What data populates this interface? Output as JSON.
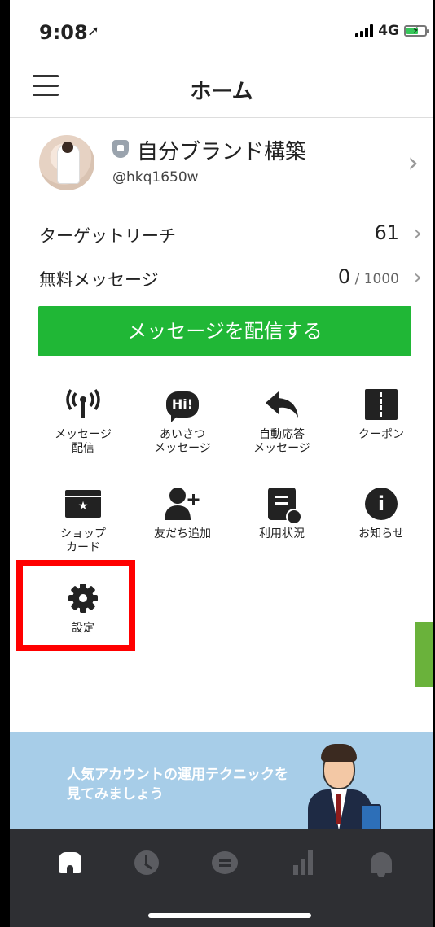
{
  "status": {
    "time": "9:08",
    "network": "4G"
  },
  "header": {
    "title": "ホーム"
  },
  "account": {
    "name": "自分ブランド構築",
    "id": "@hkq1650w"
  },
  "stats": [
    {
      "label": "ターゲットリーチ",
      "value": "61",
      "sub": ""
    },
    {
      "label": "無料メッセージ",
      "value": "0",
      "sub": " / 1000"
    }
  ],
  "send_button": {
    "label": "メッセージを配信する",
    "color": "#20b736"
  },
  "menu": [
    {
      "label": "メッセージ\n配信",
      "icon": "broadcast-icon"
    },
    {
      "label": "あいさつ\nメッセージ",
      "icon": "hi-bubble-icon",
      "icon_text": "Hi!"
    },
    {
      "label": "自動応答\nメッセージ",
      "icon": "reply-arrow-icon"
    },
    {
      "label": "クーポン",
      "icon": "coupon-icon"
    },
    {
      "label": "ショップ\nカード",
      "icon": "shop-card-icon"
    },
    {
      "label": "友だち追加",
      "icon": "add-friend-icon"
    },
    {
      "label": "利用状況",
      "icon": "usage-icon"
    },
    {
      "label": "お知らせ",
      "icon": "info-icon",
      "icon_text": "i"
    },
    {
      "label": "設定",
      "icon": "gear-icon"
    }
  ],
  "highlight_color": "#ff0000",
  "banner": {
    "text": "人気アカウントの運用テクニックを\n見てみましょう",
    "bg": "#a7cde8"
  },
  "bottom_nav": [
    "home-icon",
    "clock-icon",
    "chat-icon",
    "stats-icon",
    "bell-icon"
  ]
}
